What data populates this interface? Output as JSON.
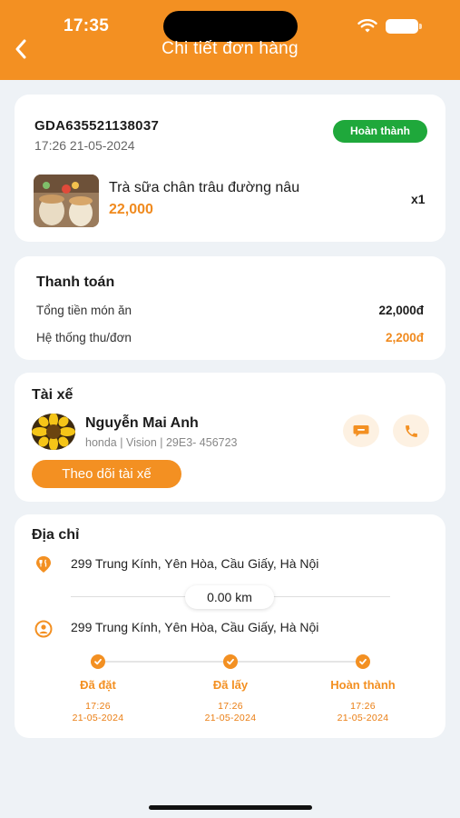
{
  "status_bar": {
    "time": "17:35"
  },
  "header": {
    "title": "Chi tiết đơn hàng"
  },
  "order": {
    "code": "GDA635521138037",
    "datetime": "17:26 21-05-2024",
    "status": "Hoàn thành",
    "item": {
      "name": "Trà sữa chân trâu đường nâu",
      "price": "22,000",
      "quantity": "x1"
    }
  },
  "payment": {
    "title": "Thanh toán",
    "rows": [
      {
        "label": "Tổng tiền món ăn",
        "value": "22,000đ"
      },
      {
        "label": "Hệ thống thu/đơn",
        "value": "2,200đ"
      }
    ]
  },
  "driver": {
    "title": "Tài xế",
    "name": "Nguyễn Mai Anh",
    "vehicle": "honda | Vision | 29E3- 456723",
    "track_label": "Theo dõi tài xế"
  },
  "address": {
    "title": "Địa chỉ",
    "pickup": "299 Trung Kính, Yên Hòa, Cầu Giấy, Hà Nội",
    "dropoff": "299 Trung Kính, Yên Hòa, Cầu Giấy, Hà Nội",
    "distance": "0.00 km"
  },
  "steps": [
    {
      "label": "Đã đặt",
      "time": "17:26",
      "date": "21-05-2024"
    },
    {
      "label": "Đã lấy",
      "time": "17:26",
      "date": "21-05-2024"
    },
    {
      "label": "Hoàn thành",
      "time": "17:26",
      "date": "21-05-2024"
    }
  ],
  "colors": {
    "brand": "#f39022",
    "success": "#1fa83b",
    "background": "#eef2f6"
  }
}
